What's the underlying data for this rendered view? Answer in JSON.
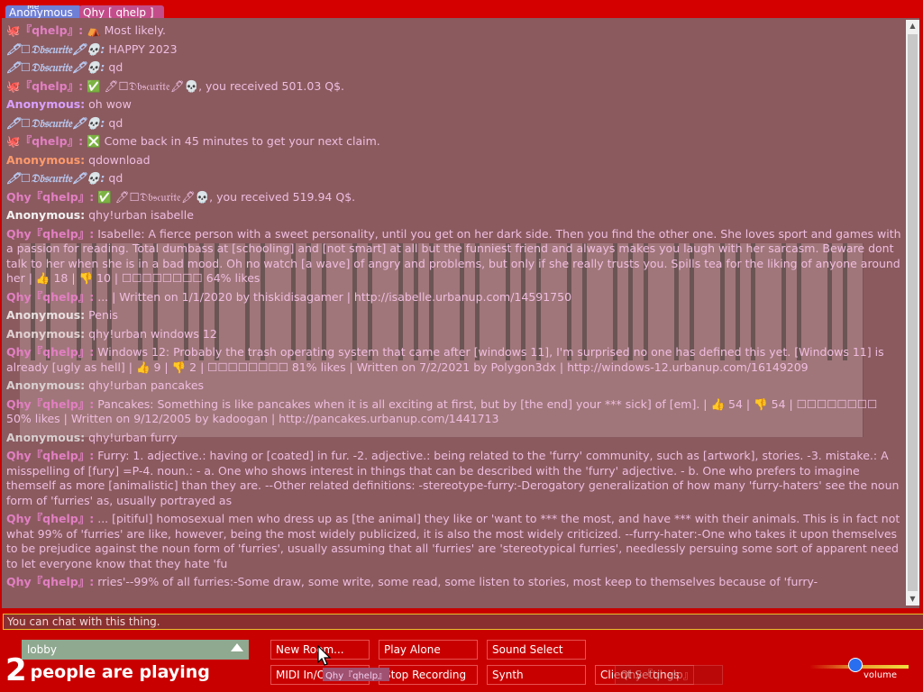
{
  "top_tabs": {
    "me_label": "Me",
    "tab1": "Anonymous",
    "tab2": "Qhy [ qhelp ]"
  },
  "chat": {
    "messages": [
      {
        "nick": "🐙『qhelp』:",
        "nick_class": "n-qhy",
        "text": "⛺ Most likely."
      },
      {
        "nick": "🖊☐𝔇𝔟𝔰𝔠𝔲𝔯𝔦𝔱𝔢🖋💀:",
        "nick_class": "n-obs",
        "text": "HAPPY 2023"
      },
      {
        "nick": "🖊☐𝔇𝔟𝔰𝔠𝔲𝔯𝔦𝔱𝔢🖋💀:",
        "nick_class": "n-obs",
        "text": "qd"
      },
      {
        "nick": "🐙『qhelp』:",
        "nick_class": "n-qhy",
        "text": "✅ 🖊☐𝔇𝔟𝔰𝔠𝔲𝔯𝔦𝔱𝔢🖋💀, you received 501.03 Q$."
      },
      {
        "nick": "Anonymous:",
        "nick_class": "n-anon1",
        "text": "oh wow"
      },
      {
        "nick": "🖊☐𝔇𝔟𝔰𝔠𝔲𝔯𝔦𝔱𝔢🖋💀:",
        "nick_class": "n-obs",
        "text": "qd"
      },
      {
        "nick": "🐙『qhelp』:",
        "nick_class": "n-qhy",
        "text": "❎ Come back in 45 minutes to get your next claim."
      },
      {
        "nick": "Anonymous:",
        "nick_class": "n-anon2",
        "text": "qdownload"
      },
      {
        "nick": "🖊☐𝔇𝔟𝔰𝔠𝔲𝔯𝔦𝔱𝔢🖋💀:",
        "nick_class": "n-obs",
        "text": "qd"
      },
      {
        "nick": "Qhy『qhelp』:",
        "nick_class": "n-qhy",
        "text": "✅ 🖊☐𝔇𝔟𝔰𝔠𝔲𝔯𝔦𝔱𝔢🖋💀, you received 519.94 Q$."
      },
      {
        "nick": "Anonymous:",
        "nick_class": "n-anon3",
        "text": "qhy!urban isabelle"
      },
      {
        "nick": "Qhy『qhelp』:",
        "nick_class": "n-qhy",
        "text": "Isabelle: A fierce person with a sweet personality, until you get on her dark side. Then you find the other one. She loves sport and games with a passion for reading. Total dumbass at [schooling] and [not smart] at all but the funniest friend and always makes you laugh with her sarcasm. Beware dont talk to her when she is in a bad mood. Oh no watch [a wave] of angry and problems, but only if she really trusts you. Spills tea for the liking of anyone around her | 👍 18 | 👎 10 | ☐☐☐☐☐☐☐☐ 64% likes"
      },
      {
        "nick": "Qhy『qhelp』:",
        "nick_class": "n-qhy",
        "text": "... | Written on 1/1/2020 by thiskidisagamer | http://isabelle.urbanup.com/14591750"
      },
      {
        "nick": "Anonymous:",
        "nick_class": "n-anon4",
        "text": "Penis"
      },
      {
        "nick": "Anonymous:",
        "nick_class": "n-anon5",
        "text": "qhy!urban windows 12"
      },
      {
        "nick": "Qhy『qhelp』:",
        "nick_class": "n-qhy",
        "text": "Windows 12: Probably the trash operating system that came after [windows 11], I'm surprised no one has defined this yet. [Windows 11] is already [ugly as hell] | 👍 9 | 👎 2 | ☐☐☐☐☐☐☐☐ 81% likes | Written on 7/2/2021 by Polygon3dx | http://windows-12.urbanup.com/16149209"
      },
      {
        "nick": "Anonymous:",
        "nick_class": "n-anon6",
        "text": "qhy!urban pancakes"
      },
      {
        "nick": "Qhy『qhelp』:",
        "nick_class": "n-qhy",
        "text": "Pancakes: Something is like pancakes when it is all exciting at first, but by [the end] your *** sick] of [em]. | 👍 54 | 👎 54 | ☐☐☐☐☐☐☐☐ 50% likes | Written on 9/12/2005 by kadoogan | http://pancakes.urbanup.com/1441713"
      },
      {
        "nick": "Anonymous:",
        "nick_class": "n-anon6",
        "text": "qhy!urban furry"
      },
      {
        "nick": "Qhy『qhelp』:",
        "nick_class": "n-qhy",
        "text": "Furry: 1. adjective.: having or [coated] in fur. -2. adjective.: being related to the 'furry' community, such as [artwork], stories. -3. mistake.: A misspelling of [fury] =P-4. noun.: - a. One who shows interest in things that can be described with the 'furry' adjective. - b. One who prefers to imagine themself as more [animalistic] than they are. --Other related definitions: -stereotype-furry:-Derogatory generalization of how many 'furry-haters' see the noun form of 'furries' as, usually portrayed as"
      },
      {
        "nick": "Qhy『qhelp』:",
        "nick_class": "n-qhy",
        "text": "... [pitiful] homosexual men who dress up as [the animal] they like or 'want to *** the most, and have *** with their animals. This is in fact not what 99% of 'furries' are like, however, being the most widely publicized, it is also the most widely criticized. --furry-hater:-One who takes it upon themselves to be prejudice against the noun form of 'furries', usually assuming that all 'furries' are 'stereotypical furries', needlessly persuing some sort of apparent need to let everyone know that they hate 'fu"
      },
      {
        "nick": "Qhy『qhelp』:",
        "nick_class": "n-qhy",
        "text": "rries'--99% of all furries:-Some draw, some write, some read, some listen to stories, most keep to themselves because of 'furry-"
      }
    ]
  },
  "input": {
    "placeholder": "You can chat with this thing."
  },
  "controls": {
    "room": "lobby",
    "player_count": "2",
    "players_label": "people are playing",
    "new_room": "New Room...",
    "play_alone": "Play Alone",
    "sound_select": "Sound Select",
    "midi": "MIDI In/Out",
    "stop_recording": "Stop Recording",
    "synth": "Synth",
    "client_settings": "Client Settings",
    "extra_button": "Qhy『qhelp』",
    "cursor_tag": "Qhy『qhelp』",
    "volume_label": "volume"
  },
  "colors": {
    "background": "#c80000",
    "chat_panel": "#8a5a5f",
    "input_border": "#e8c030",
    "volume_knob": "#2a6ef0"
  },
  "volume_level": 0.45
}
